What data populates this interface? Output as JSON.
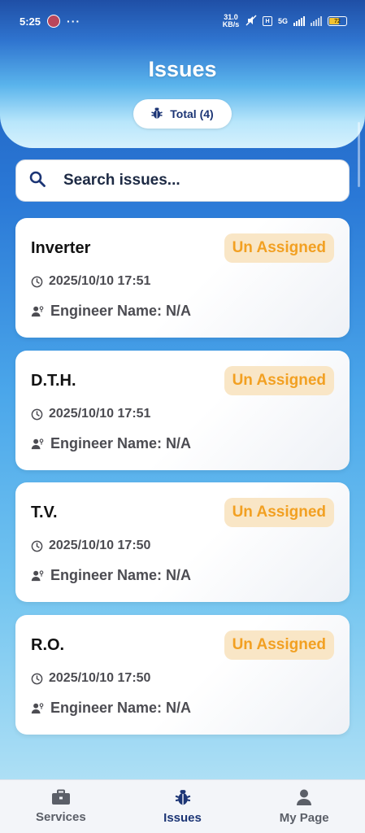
{
  "status_bar": {
    "time": "5:25",
    "dots": "···",
    "net_speed": "31.0 KB/s",
    "network": "5G",
    "battery": "72"
  },
  "header": {
    "title": "Issues",
    "total_label": "Total (4)"
  },
  "search": {
    "placeholder": "Search issues..."
  },
  "issues": [
    {
      "title": "Inverter",
      "status": "Un Assigned",
      "datetime": "2025/10/10 17:51",
      "engineer": "Engineer Name: N/A"
    },
    {
      "title": "D.T.H.",
      "status": "Un Assigned",
      "datetime": "2025/10/10 17:51",
      "engineer": "Engineer Name: N/A"
    },
    {
      "title": "T.V.",
      "status": "Un Assigned",
      "datetime": "2025/10/10 17:50",
      "engineer": "Engineer Name: N/A"
    },
    {
      "title": "R.O.",
      "status": "Un Assigned",
      "datetime": "2025/10/10 17:50",
      "engineer": "Engineer Name: N/A"
    }
  ],
  "bottom_nav": [
    {
      "label": "Services",
      "icon": "briefcase-icon",
      "active": false
    },
    {
      "label": "Issues",
      "icon": "bug-icon",
      "active": true
    },
    {
      "label": "My Page",
      "icon": "person-icon",
      "active": false
    }
  ],
  "colors": {
    "primary": "#1c3575",
    "status_text": "#f2a022",
    "status_bg": "#f9e6c6"
  }
}
